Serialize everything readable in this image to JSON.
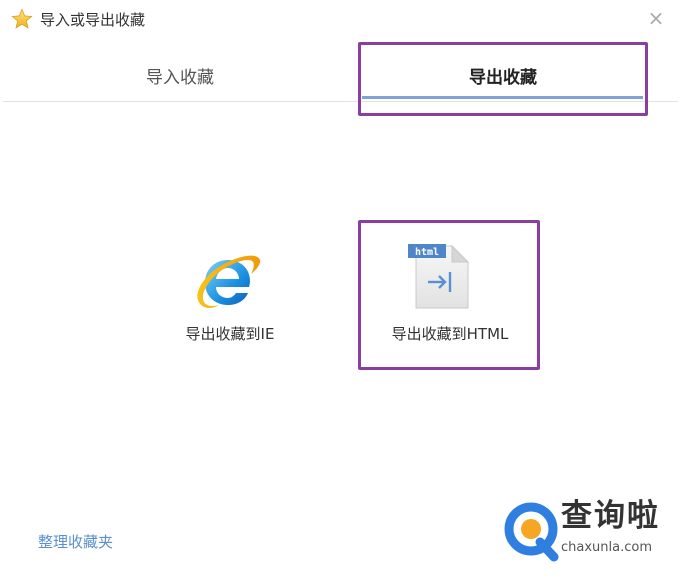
{
  "window": {
    "title": "导入或导出收藏",
    "title_icon": "star-icon",
    "close_glyph": "×"
  },
  "tabs": [
    {
      "label": "导入收藏",
      "active": false
    },
    {
      "label": "导出收藏",
      "active": true
    }
  ],
  "options": [
    {
      "label": "导出收藏到IE",
      "icon": "ie-browser-icon"
    },
    {
      "label": "导出收藏到HTML",
      "icon": "html-file-icon",
      "icon_badge": "html"
    }
  ],
  "footer": {
    "manage_link": "整理收藏夹"
  },
  "watermark": {
    "text": "查询啦",
    "url": "chaxunla.com"
  },
  "colors": {
    "highlight": "#8a3fa0",
    "tab_underline": "#7da3d6",
    "link": "#5a8fd0",
    "watermark_blue": "#2f7fe0"
  }
}
